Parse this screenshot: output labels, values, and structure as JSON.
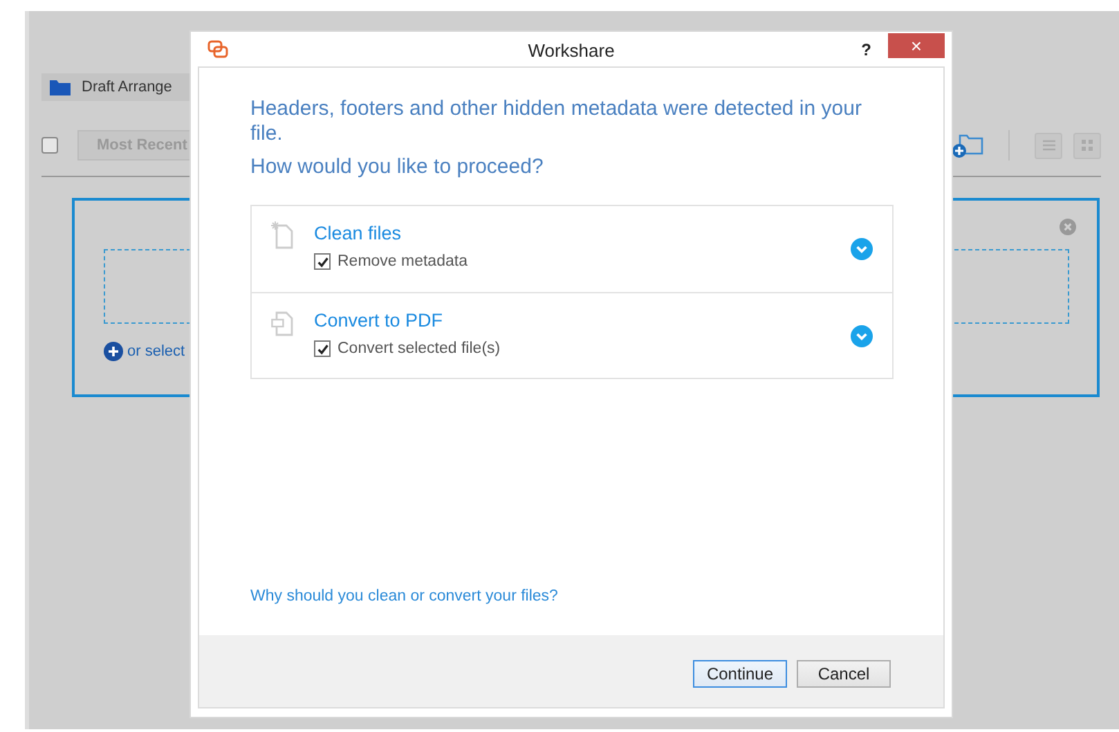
{
  "app": {
    "breadcrumb": [
      "Draft Arrange"
    ],
    "toolbar": {
      "select_all": {
        "checked": false
      },
      "sort_button": "Most Recent"
    },
    "drop_zone": {
      "link": "or select"
    }
  },
  "dialog": {
    "title": "Workshare",
    "help": "?",
    "close": "×",
    "message": "Headers, footers and other hidden metadata were detected in your file.",
    "question": "How would you like to proceed?",
    "options": [
      {
        "kind": "clean",
        "title": "Clean files",
        "expanded": false,
        "checkbox": {
          "label": "Remove metadata",
          "checked": true
        }
      },
      {
        "kind": "convert",
        "title": "Convert to PDF",
        "expanded": false,
        "checkbox": {
          "label": "Convert selected file(s)",
          "checked": true
        }
      }
    ],
    "link": "Why should you clean or convert your files?",
    "buttons": [
      {
        "label": "Continue",
        "default": true
      },
      {
        "label": "Cancel",
        "default": false
      }
    ]
  }
}
